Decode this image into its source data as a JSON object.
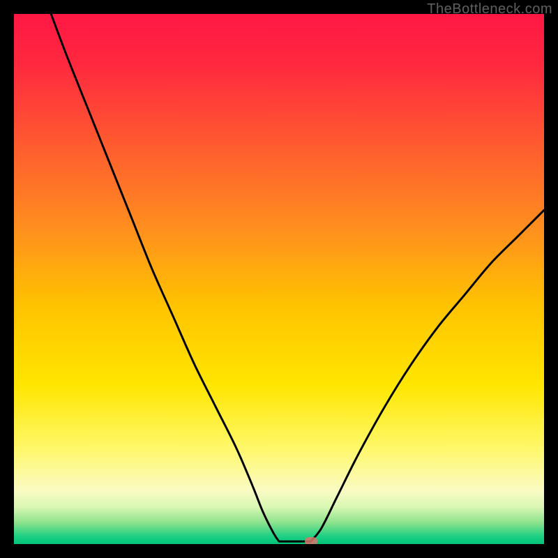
{
  "watermark": "TheBottleneck.com",
  "colors": {
    "frame": "#000000",
    "curve": "#000000",
    "marker": "#d8766c",
    "gradient_stops": [
      {
        "offset": 0.0,
        "color": "#ff1744"
      },
      {
        "offset": 0.1,
        "color": "#ff2a3f"
      },
      {
        "offset": 0.25,
        "color": "#ff5c2f"
      },
      {
        "offset": 0.4,
        "color": "#ff8d1f"
      },
      {
        "offset": 0.55,
        "color": "#ffc300"
      },
      {
        "offset": 0.7,
        "color": "#ffe600"
      },
      {
        "offset": 0.82,
        "color": "#fff86b"
      },
      {
        "offset": 0.9,
        "color": "#fafbc4"
      },
      {
        "offset": 0.93,
        "color": "#d9f7b3"
      },
      {
        "offset": 0.96,
        "color": "#8be28c"
      },
      {
        "offset": 0.985,
        "color": "#1fd084"
      },
      {
        "offset": 1.0,
        "color": "#00c47a"
      }
    ]
  },
  "chart_data": {
    "type": "line",
    "title": "",
    "xlabel": "",
    "ylabel": "",
    "xlim": [
      0,
      100
    ],
    "ylim": [
      0,
      100
    ],
    "curve_left": [
      {
        "x": 7,
        "y": 100
      },
      {
        "x": 10,
        "y": 92
      },
      {
        "x": 14,
        "y": 82
      },
      {
        "x": 18,
        "y": 72
      },
      {
        "x": 22,
        "y": 62
      },
      {
        "x": 26,
        "y": 52
      },
      {
        "x": 30,
        "y": 43
      },
      {
        "x": 34,
        "y": 34
      },
      {
        "x": 38,
        "y": 26
      },
      {
        "x": 42,
        "y": 18
      },
      {
        "x": 45,
        "y": 11
      },
      {
        "x": 47,
        "y": 6
      },
      {
        "x": 49,
        "y": 2
      },
      {
        "x": 50,
        "y": 0.5
      }
    ],
    "curve_flat": [
      {
        "x": 50,
        "y": 0.5
      },
      {
        "x": 56,
        "y": 0.5
      }
    ],
    "curve_right": [
      {
        "x": 56,
        "y": 0.5
      },
      {
        "x": 58,
        "y": 3
      },
      {
        "x": 61,
        "y": 9
      },
      {
        "x": 65,
        "y": 17
      },
      {
        "x": 70,
        "y": 26
      },
      {
        "x": 75,
        "y": 34
      },
      {
        "x": 80,
        "y": 41
      },
      {
        "x": 85,
        "y": 47
      },
      {
        "x": 90,
        "y": 53
      },
      {
        "x": 95,
        "y": 58
      },
      {
        "x": 100,
        "y": 63
      }
    ],
    "marker": {
      "x": 56,
      "y": 0.5
    }
  }
}
